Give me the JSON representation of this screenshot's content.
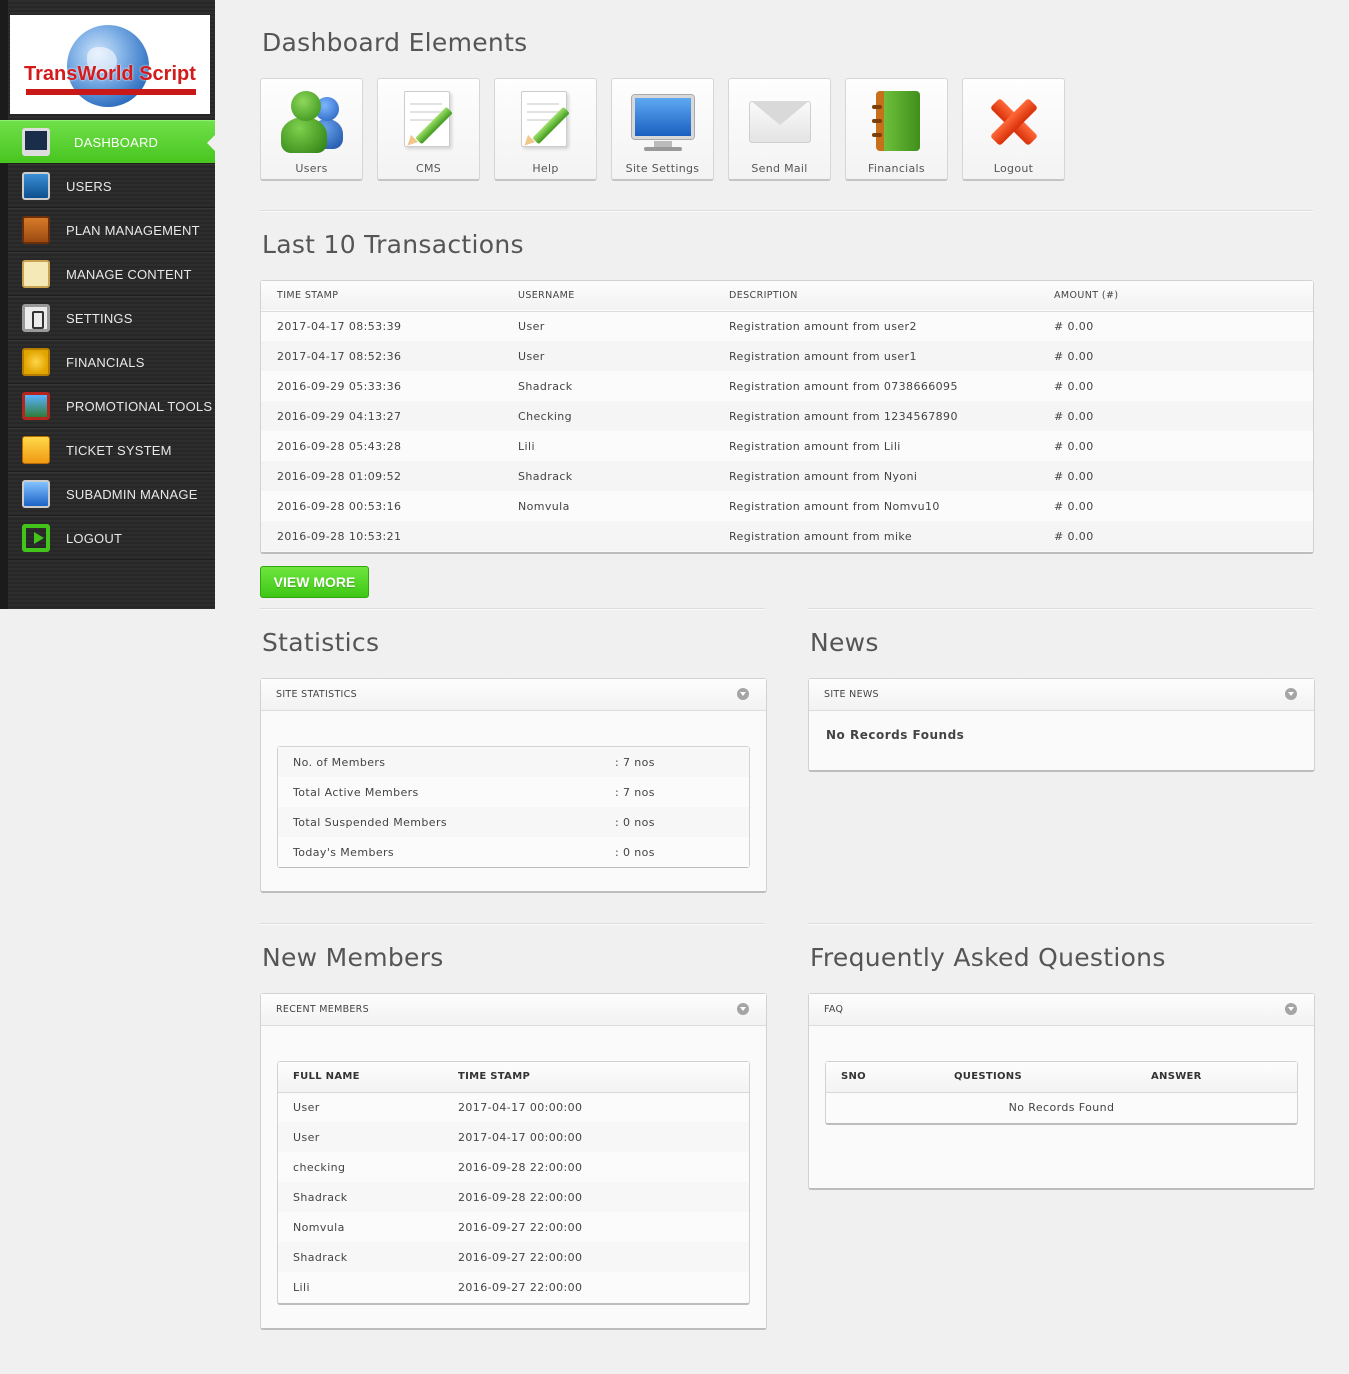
{
  "brand": {
    "logo_text": "TransWorld Script"
  },
  "sidebar": {
    "items": [
      {
        "label": "DASHBOARD",
        "icon": "monitor-icon",
        "active": true
      },
      {
        "label": "USERS",
        "icon": "users-icon"
      },
      {
        "label": "PLAN MANAGEMENT",
        "icon": "plan-icon"
      },
      {
        "label": "MANAGE CONTENT",
        "icon": "clipboard-icon"
      },
      {
        "label": "SETTINGS",
        "icon": "settings-icon"
      },
      {
        "label": "FINANCIALS",
        "icon": "coin-icon"
      },
      {
        "label": "PROMOTIONAL TOOLS",
        "icon": "picture-icon"
      },
      {
        "label": "TICKET SYSTEM",
        "icon": "ticket-icon"
      },
      {
        "label": "SUBADMIN MANAGE",
        "icon": "finder-icon"
      },
      {
        "label": "LOGOUT",
        "icon": "logout-icon"
      }
    ]
  },
  "dashboard": {
    "title": "Dashboard Elements",
    "tiles": [
      {
        "label": "Users",
        "icon": "users-icon"
      },
      {
        "label": "CMS",
        "icon": "document-pencil-icon"
      },
      {
        "label": "Help",
        "icon": "document-pencil-icon"
      },
      {
        "label": "Site Settings",
        "icon": "monitor-icon"
      },
      {
        "label": "Send Mail",
        "icon": "envelope-icon"
      },
      {
        "label": "Financials",
        "icon": "ledger-icon"
      },
      {
        "label": "Logout",
        "icon": "close-x-icon"
      }
    ]
  },
  "transactions": {
    "title": "Last 10 Transactions",
    "columns": [
      "TIME STAMP",
      "USERNAME",
      "DESCRIPTION",
      "AMOUNT (#)"
    ],
    "rows": [
      [
        "2017-04-17 08:53:39",
        "User",
        "Registration amount from user2",
        "# 0.00"
      ],
      [
        "2017-04-17 08:52:36",
        "User",
        "Registration amount from user1",
        "# 0.00"
      ],
      [
        "2016-09-29 05:33:36",
        "Shadrack",
        "Registration amount from 0738666095",
        "# 0.00"
      ],
      [
        "2016-09-29 04:13:27",
        "Checking",
        "Registration amount from 1234567890",
        "# 0.00"
      ],
      [
        "2016-09-28 05:43:28",
        "Lili",
        "Registration amount from Lili",
        "# 0.00"
      ],
      [
        "2016-09-28 01:09:52",
        "Shadrack",
        "Registration amount from Nyoni",
        "# 0.00"
      ],
      [
        "2016-09-28 00:53:16",
        "Nomvula",
        "Registration amount from Nomvu10",
        "# 0.00"
      ],
      [
        "2016-09-28 10:53:21",
        "",
        "Registration amount from mike",
        "# 0.00"
      ]
    ],
    "view_more": "VIEW MORE"
  },
  "statistics": {
    "title": "Statistics",
    "panel_title": "SITE STATISTICS",
    "rows": [
      [
        "No. of Members",
        ": 7 nos"
      ],
      [
        "Total Active Members",
        ": 7 nos"
      ],
      [
        "Total Suspended Members",
        ": 0 nos"
      ],
      [
        "Today's Members",
        ": 0 nos"
      ]
    ]
  },
  "news": {
    "title": "News",
    "panel_title": "SITE NEWS",
    "empty": "No Records Founds"
  },
  "new_members": {
    "title": "New Members",
    "panel_title": "RECENT MEMBERS",
    "columns": [
      "FULL NAME",
      "TIME STAMP"
    ],
    "rows": [
      [
        "User",
        "2017-04-17 00:00:00"
      ],
      [
        "User",
        "2017-04-17 00:00:00"
      ],
      [
        "checking",
        "2016-09-28 22:00:00"
      ],
      [
        "Shadrack",
        "2016-09-28 22:00:00"
      ],
      [
        "Nomvula",
        "2016-09-27 22:00:00"
      ],
      [
        "Shadrack",
        "2016-09-27 22:00:00"
      ],
      [
        "Lili",
        "2016-09-27 22:00:00"
      ]
    ]
  },
  "faq": {
    "title": "Frequently Asked Questions",
    "panel_title": "FAQ",
    "columns": [
      "SNO",
      "QUESTIONS",
      "ANSWER"
    ],
    "empty": "No Records Found"
  },
  "colors": {
    "accent_green": "#48c51f",
    "sidebar_bg": "#2a2a2a"
  }
}
